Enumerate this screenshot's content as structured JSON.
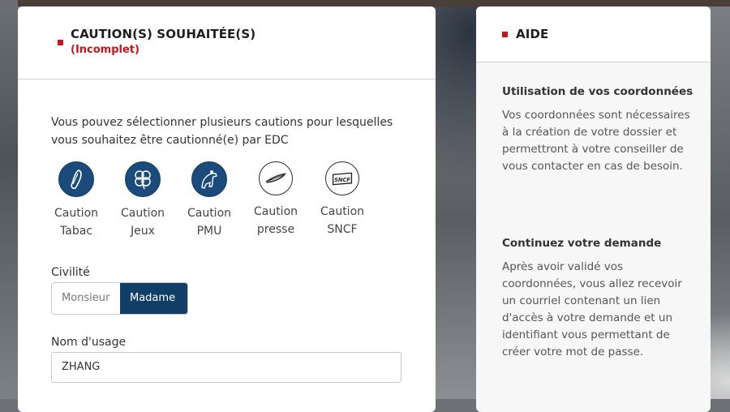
{
  "form": {
    "title": "CAUTION(S) SOUHAITÉE(S)",
    "status": "(Incomplet)",
    "intro": "Vous pouvez sélectionner plusieurs cautions pour lesquelles vous souhaitez être cautionné(e) par EDC",
    "options": [
      {
        "label": "Caution Tabac",
        "icon": "tabac-icon"
      },
      {
        "label": "Caution Jeux",
        "icon": "jeux-icon"
      },
      {
        "label": "Caution PMU",
        "icon": "pmu-icon"
      },
      {
        "label": "Caution presse",
        "icon": "presse-icon"
      },
      {
        "label": "Caution SNCF",
        "icon": "sncf-icon",
        "icon_text": "SNCF"
      }
    ],
    "civility_label": "Civilité",
    "civility_options": [
      "Monsieur",
      "Madame"
    ],
    "civility_selected": "Madame",
    "name_label": "Nom d'usage",
    "name_value": "ZHANG"
  },
  "help": {
    "title": "AIDE",
    "sections": [
      {
        "title": "Utilisation de vos coordonnées",
        "text": "Vos coordonnées sont nécessaires à la création de votre dossier et permettront à votre conseiller de vous contacter en cas de besoin."
      },
      {
        "title": "Continuez votre demande",
        "text": "Après avoir validé vos coordonnées, vous allez recevoir un courriel contenant un lien d'accès à votre demande et un identifiant vous permettant de créer votre mot de passe."
      }
    ]
  },
  "colors": {
    "accent_red": "#c4161c",
    "primary_blue": "#113e66",
    "icon_blue": "#1a4b7b"
  }
}
